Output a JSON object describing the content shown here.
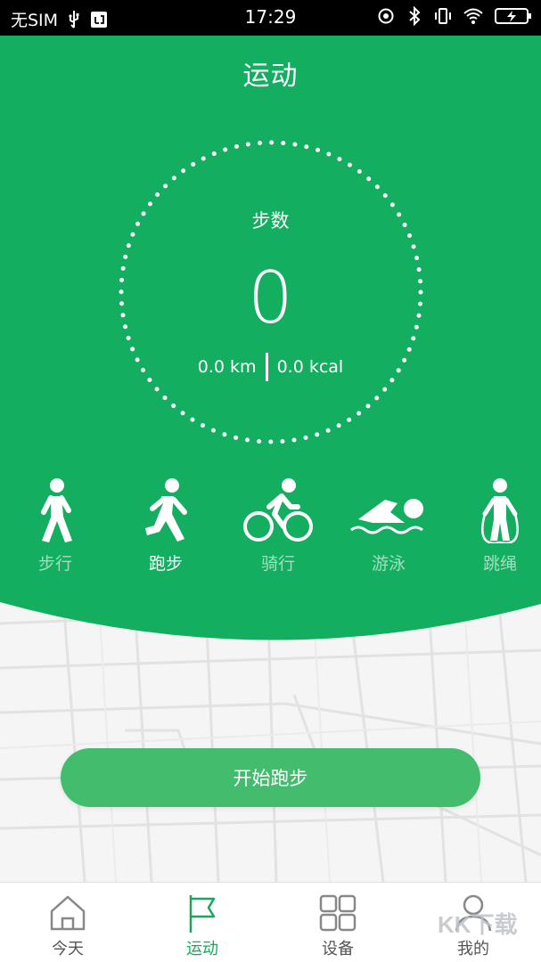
{
  "status_bar": {
    "carrier": "无SIM",
    "time": "17:29",
    "icons": [
      "usb-icon",
      "debug-icon",
      "rotation-lock-icon",
      "bluetooth-icon",
      "vibrate-icon",
      "wifi-icon",
      "battery-charging-icon"
    ]
  },
  "header": {
    "title": "运动"
  },
  "summary": {
    "steps_label": "步数",
    "steps_value": "0",
    "distance": "0.0 km",
    "calories": "0.0 kcal"
  },
  "activities": [
    {
      "label": "步行",
      "icon": "walking-icon",
      "active": false
    },
    {
      "label": "跑步",
      "icon": "running-icon",
      "active": true
    },
    {
      "label": "骑行",
      "icon": "cycling-icon",
      "active": false
    },
    {
      "label": "游泳",
      "icon": "swimming-icon",
      "active": false
    },
    {
      "label": "跳绳",
      "icon": "jump-rope-icon",
      "active": false
    }
  ],
  "start_button": {
    "label": "开始跑步"
  },
  "bottom_nav": {
    "items": [
      {
        "label": "今天",
        "icon": "home-icon",
        "active": false
      },
      {
        "label": "运动",
        "icon": "flag-icon",
        "active": true
      },
      {
        "label": "设备",
        "icon": "grid-icon",
        "active": false
      },
      {
        "label": "我的",
        "icon": "person-icon",
        "active": false
      }
    ]
  },
  "watermark": {
    "text": "KK下载"
  },
  "colors": {
    "primary_green": "#13ae5f",
    "button_green": "#43bc6e",
    "active_nav": "#1aa75b"
  }
}
